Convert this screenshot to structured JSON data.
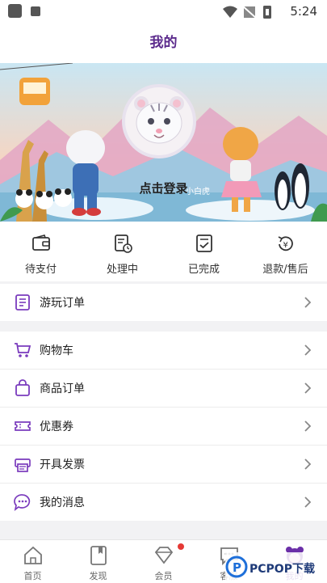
{
  "status_bar": {
    "time": "5:24"
  },
  "header": {
    "title": "我的"
  },
  "banner": {
    "login_text": "点击登录",
    "sign_text": "小白虎"
  },
  "orders": [
    {
      "label": "待支付",
      "icon": "wallet-icon"
    },
    {
      "label": "处理中",
      "icon": "processing-doc-icon"
    },
    {
      "label": "已完成",
      "icon": "check-doc-icon"
    },
    {
      "label": "退款/售后",
      "icon": "refund-icon"
    }
  ],
  "menu": {
    "play_orders": {
      "label": "游玩订单"
    },
    "cart": {
      "label": "购物车"
    },
    "goods_orders": {
      "label": "商品订单"
    },
    "coupons": {
      "label": "优惠券"
    },
    "invoice": {
      "label": "开具发票"
    },
    "messages": {
      "label": "我的消息"
    }
  },
  "tabbar": [
    {
      "label": "首页",
      "icon": "home-icon"
    },
    {
      "label": "发现",
      "icon": "bookmark-icon"
    },
    {
      "label": "会员",
      "icon": "diamond-icon"
    },
    {
      "label": "客服",
      "icon": "chat-icon"
    },
    {
      "label": "我的",
      "icon": "tiger-face-icon"
    }
  ],
  "watermark": {
    "text": "PCPOP下载"
  },
  "colors": {
    "accent": "#6b2fa8",
    "title": "#5b2a8c",
    "badge": "#e53935"
  }
}
